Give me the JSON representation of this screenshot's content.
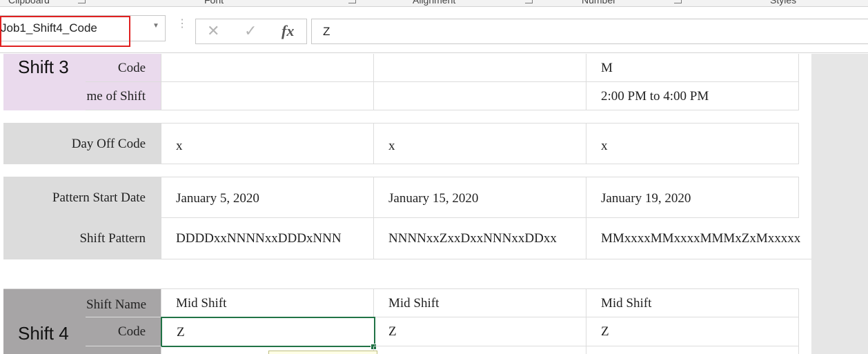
{
  "ribbon": {
    "groups": [
      "Clipboard",
      "Font",
      "Alignment",
      "Number",
      "Styles"
    ]
  },
  "formula_bar": {
    "name_box": "Job1_Shift4_Code",
    "cancel_icon": "x-icon",
    "enter_icon": "check-icon",
    "fx_label": "fx",
    "formula": "Z"
  },
  "shift3": {
    "title": "Shift 3",
    "code_label": "Code",
    "time_label": "me of Shift",
    "codes": [
      "",
      "",
      "M"
    ],
    "times": [
      "",
      "",
      "2:00 PM to 4:00 PM"
    ]
  },
  "day_off": {
    "label": "Day Off Code",
    "values": [
      "x",
      "x",
      "x"
    ]
  },
  "pattern": {
    "start_label": "Pattern Start Date",
    "start_dates": [
      "January 5, 2020",
      "January 15, 2020",
      "January 19, 2020"
    ],
    "shift_label": "Shift Pattern",
    "shift_patterns": [
      "DDDDxxNNNNxxDDDxNNN",
      "NNNNxxZxxDxxNNNxxDDxx",
      "MMxxxxMMxxxxMMMxZxMxxxxx"
    ]
  },
  "shift4": {
    "title": "Shift 4",
    "name_label": "Shift Name",
    "code_label": "Code",
    "names": [
      "Mid Shift",
      "Mid Shift",
      "Mid Shift"
    ],
    "codes": [
      "Z",
      "Z",
      "Z"
    ]
  },
  "colors": {
    "shift3_fill": "#eadaed",
    "label_fill": "#dcdcdc",
    "shift4_fill": "#a7a5a6",
    "selection": "#217346",
    "name_box_highlight": "#e02020"
  }
}
